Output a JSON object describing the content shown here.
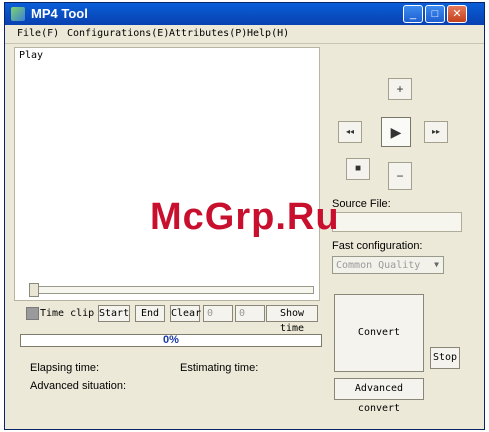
{
  "window": {
    "title": "MP4 Tool"
  },
  "menu": [
    "File(F)",
    "Configurations(E)",
    "Attributes(P)",
    "Help(H)"
  ],
  "player": {
    "panel_label": "Play",
    "controls": {
      "up": "+",
      "rewind": "◂◂",
      "play": "▶",
      "forward": "▸▸",
      "stop": "■",
      "down": "−"
    }
  },
  "clip": {
    "time_clip_label": "Time clip",
    "start_label": "Start",
    "end_label": "End",
    "clear_label": "Clear",
    "value1": "0",
    "value2": "0",
    "show_time_label": "Show time"
  },
  "progress": {
    "text": "0%",
    "fraction": 0
  },
  "status": {
    "elapsing_label": "Elapsing time:",
    "estimating_label": "Estimating time:",
    "advanced_situation_label": "Advanced situation:"
  },
  "source": {
    "label": "Source File:",
    "value": ""
  },
  "fast_config": {
    "label": "Fast configuration:",
    "selected": "Common Quality"
  },
  "actions": {
    "convert": "Convert",
    "stop": "Stop",
    "advanced_convert": "Advanced convert"
  },
  "watermark": {
    "text": "McGrp.Ru"
  }
}
